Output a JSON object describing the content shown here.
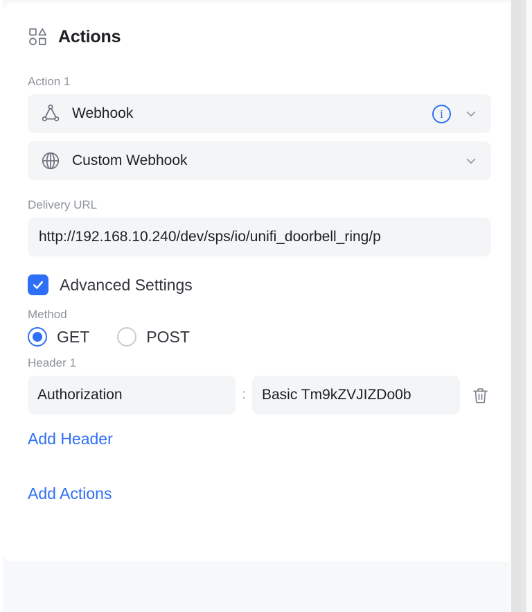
{
  "panel": {
    "title": "Actions",
    "title_icon": "shapes-grid-icon"
  },
  "action": {
    "label": "Action 1",
    "type": {
      "icon": "webhook-icon",
      "value": "Webhook",
      "info_icon": "info-circle-icon",
      "chevron_icon": "chevron-down-icon"
    },
    "subtype": {
      "icon": "globe-icon",
      "value": "Custom Webhook",
      "chevron_icon": "chevron-down-icon"
    },
    "delivery_url": {
      "label": "Delivery URL",
      "value": "http://192.168.10.240/dev/sps/io/unifi_doorbell_ring/p"
    },
    "advanced_settings": {
      "label": "Advanced Settings",
      "checked": true,
      "check_icon": "checkmark-icon"
    },
    "method": {
      "label": "Method",
      "options": [
        {
          "label": "GET",
          "selected": true
        },
        {
          "label": "POST",
          "selected": false
        }
      ]
    },
    "header": {
      "label": "Header 1",
      "key": "Authorization",
      "separator": ":",
      "value": "Basic Tm9kZVJIZDo0b",
      "delete_icon": "trash-icon"
    },
    "add_header_label": "Add Header"
  },
  "add_actions_label": "Add Actions",
  "colors": {
    "accent": "#2f6ff5",
    "field_bg": "#f4f5f7",
    "label_text": "#8d929b",
    "body_text": "#1d1f23",
    "page_bg": "#f7f8f9",
    "card_bg": "#ffffff",
    "icon_gray": "#6f7681"
  }
}
